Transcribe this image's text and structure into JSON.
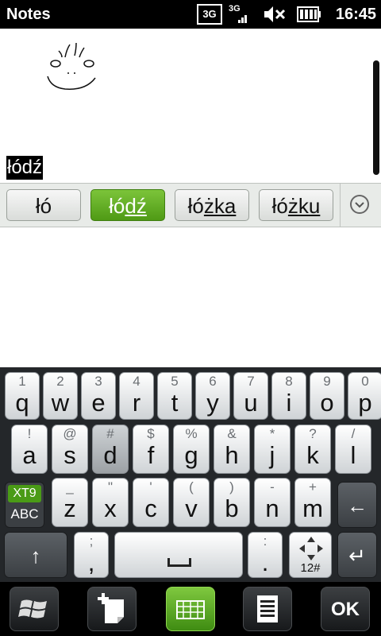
{
  "status_bar": {
    "title": "Notes",
    "network1": "3G",
    "network2": "3G",
    "time": "16:45"
  },
  "note": {
    "composing_text": "łódź",
    "drawing": "smiley-sketch"
  },
  "suggestions": [
    {
      "plain": "łó",
      "underlined": ""
    },
    {
      "plain": "łó",
      "underlined": "dź",
      "active": true
    },
    {
      "plain": "łó",
      "underlined": "żka"
    },
    {
      "plain": "łó",
      "underlined": "żku"
    }
  ],
  "keyboard": {
    "row1": [
      {
        "main": "q",
        "sub": "1"
      },
      {
        "main": "w",
        "sub": "2"
      },
      {
        "main": "e",
        "sub": "3"
      },
      {
        "main": "r",
        "sub": "4"
      },
      {
        "main": "t",
        "sub": "5"
      },
      {
        "main": "y",
        "sub": "6"
      },
      {
        "main": "u",
        "sub": "7"
      },
      {
        "main": "i",
        "sub": "8"
      },
      {
        "main": "o",
        "sub": "9"
      },
      {
        "main": "p",
        "sub": "0"
      }
    ],
    "row2": [
      {
        "main": "a",
        "sub": "!"
      },
      {
        "main": "s",
        "sub": "@"
      },
      {
        "main": "d",
        "sub": "#"
      },
      {
        "main": "f",
        "sub": "$"
      },
      {
        "main": "g",
        "sub": "%"
      },
      {
        "main": "h",
        "sub": "&"
      },
      {
        "main": "j",
        "sub": "*"
      },
      {
        "main": "k",
        "sub": "?"
      },
      {
        "main": "l",
        "sub": "/"
      }
    ],
    "row3": [
      {
        "main": "z",
        "sub": "_"
      },
      {
        "main": "x",
        "sub": "\""
      },
      {
        "main": "c",
        "sub": "'"
      },
      {
        "main": "v",
        "sub": "("
      },
      {
        "main": "b",
        "sub": ")"
      },
      {
        "main": "n",
        "sub": "-"
      },
      {
        "main": "m",
        "sub": "+"
      }
    ],
    "xt9_top": "XT9",
    "xt9_bottom": "ABC",
    "comma": {
      "main": ",",
      "sub": ";"
    },
    "period": {
      "main": ".",
      "sub": ":"
    },
    "nav_label": "12#"
  },
  "toolbar": {
    "ok_label": "OK"
  },
  "colors": {
    "accent_green": "#4f9a15",
    "keyboard_bg": "#24272a",
    "statusbar_bg": "#000000"
  }
}
